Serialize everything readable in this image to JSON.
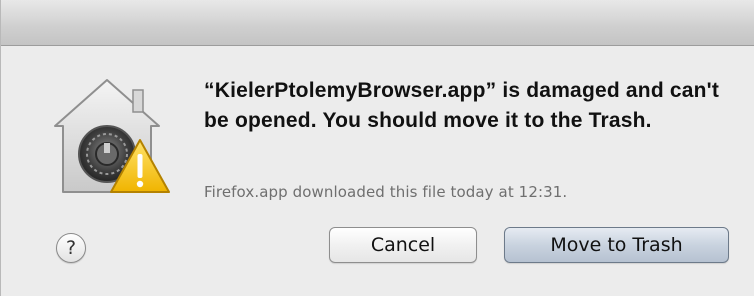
{
  "dialog": {
    "icon": "gatekeeper-warning-icon",
    "message": "“KielerPtolemyBrowser.app” is damaged and can't be opened. You should move it to the Trash.",
    "info": "Firefox.app downloaded this file today at 12:31.",
    "help_label": "?",
    "cancel_label": "Cancel",
    "default_label": "Move to Trash"
  },
  "colors": {
    "warning": "#f4c20d",
    "default_button": "#c2ccd8"
  }
}
